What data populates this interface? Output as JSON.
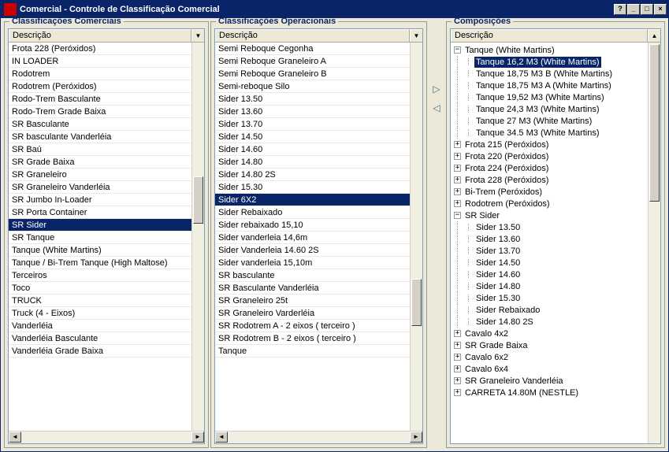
{
  "window": {
    "title": "Comercial - Controle de Classificação Comercial"
  },
  "panels": {
    "comerciais": {
      "legend": "Classificações Comerciais",
      "header": "Descrição",
      "selected_index": 15,
      "items": [
        "Frota 228 (Peróxidos)",
        "IN LOADER",
        "Rodotrem",
        "Rodotrem (Peróxidos)",
        "Rodo-Trem Basculante",
        "Rodo-Trem Grade Baixa",
        "SR Basculante",
        "SR basculante Vanderléia",
        "SR Baú",
        "SR Grade Baixa",
        "SR Graneleiro",
        "SR Graneleiro Vanderléia",
        "SR Jumbo In-Loader",
        "SR Porta Container",
        "SR Sider",
        "SR Tanque",
        "Tanque (White Martins)",
        "Tanque / Bi-Trem Tanque (High Maltose)",
        "Terceiros",
        "Toco",
        "TRUCK",
        "Truck (4 - Eixos)",
        "Vanderléia",
        "Vanderléia Basculante",
        "Vanderléia Grade Baixa"
      ]
    },
    "operacionais": {
      "legend": "Classificações Operacionais",
      "header": "Descrição",
      "selected_index": 14,
      "items": [
        "Semi Reboque Cegonha",
        "Semi Reboque Graneleiro A",
        "Semi Reboque Graneleiro B",
        "Semi-reboque Silo",
        "Sider 13.50",
        "Sider 13.60",
        "Sider 13.70",
        "Sider 14.50",
        "Sider 14.60",
        "Sider 14.80",
        "Sider 14.80 2S",
        "Sider 15.30",
        "Sider 6X2",
        "Sider Rebaixado",
        "Sider rebaixado 15,10",
        "Sider vanderleia 14,6m",
        "Sider Vanderleia 14.60 2S",
        "Sider vanderleia 15,10m",
        "SR basculante",
        "SR Basculante Vanderléia",
        "SR Graneleiro 25t",
        "SR Graneleiro Varderléia",
        "SR Rodotrem A - 2 eixos ( terceiro )",
        "SR Rodotrem B - 2 eixos ( terceiro )",
        "Tanque"
      ]
    },
    "composicoes": {
      "legend": "Composições",
      "header": "Descrição",
      "selected_path": "0.0",
      "nodes": [
        {
          "label": "Tanque (White Martins)",
          "expanded": true,
          "children": [
            {
              "label": "Tanque 16,2 M3 (White Martins)"
            },
            {
              "label": "Tanque 18,75 M3  B (White Martins)"
            },
            {
              "label": "Tanque 18,75 M3 A (White Martins)"
            },
            {
              "label": "Tanque 19,52 M3 (White Martins)"
            },
            {
              "label": "Tanque 24,3 M3 (White Martins)"
            },
            {
              "label": "Tanque 27 M3 (White Martins)"
            },
            {
              "label": "Tanque 34.5 M3 (White Martins)"
            }
          ]
        },
        {
          "label": "Frota 215 (Peróxidos)",
          "expanded": false
        },
        {
          "label": "Frota 220 (Peróxidos)",
          "expanded": false
        },
        {
          "label": "Frota 224 (Peróxidos)",
          "expanded": false
        },
        {
          "label": "Frota 228 (Peróxidos)",
          "expanded": false
        },
        {
          "label": "Bi-Trem (Peróxidos)",
          "expanded": false
        },
        {
          "label": "Rodotrem (Peróxidos)",
          "expanded": false
        },
        {
          "label": "SR Sider",
          "expanded": true,
          "children": [
            {
              "label": "Sider 13.50"
            },
            {
              "label": "Sider 13.60"
            },
            {
              "label": "Sider 13.70"
            },
            {
              "label": "Sider 14.50"
            },
            {
              "label": "Sider 14.60"
            },
            {
              "label": "Sider 14.80"
            },
            {
              "label": "Sider 15.30"
            },
            {
              "label": "Sider Rebaixado"
            },
            {
              "label": "Sider 14.80 2S"
            }
          ]
        },
        {
          "label": "Cavalo 4x2",
          "expanded": false
        },
        {
          "label": "SR Grade Baixa",
          "expanded": false
        },
        {
          "label": "Cavalo 6x2",
          "expanded": false
        },
        {
          "label": "Cavalo 6x4",
          "expanded": false
        },
        {
          "label": "SR Graneleiro Vanderléia",
          "expanded": false
        },
        {
          "label": "CARRETA 14.80M (NESTLE)",
          "expanded": false
        }
      ]
    }
  }
}
